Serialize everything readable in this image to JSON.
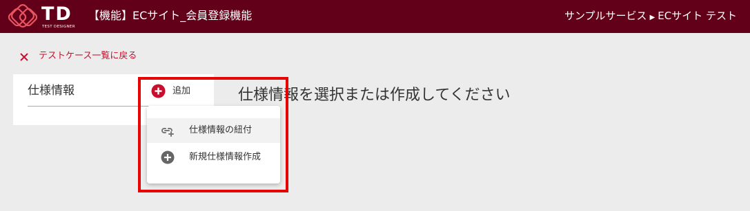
{
  "colors": {
    "header": "#620019",
    "accent": "#c8102e",
    "annotation": "#e60000"
  },
  "header": {
    "logo_text": "TD",
    "logo_subtext": "TEST DESIGNER",
    "page_title": "【機能】ECサイト_会員登録機能",
    "breadcrumb_service": "サンプルサービス",
    "breadcrumb_arrow": "▶",
    "breadcrumb_project": "ECサイト テスト"
  },
  "back_link": {
    "icon": "close-icon",
    "label": "テストケース一覧に戻る"
  },
  "spec_panel": {
    "title": "仕様情報",
    "add_button": {
      "icon": "plus-circle-icon",
      "label": "追加"
    }
  },
  "add_menu": {
    "items": [
      {
        "icon": "link-add-icon",
        "label": "仕様情報の紐付"
      },
      {
        "icon": "plus-circle-icon",
        "label": "新規仕様情報作成"
      }
    ]
  },
  "main": {
    "placeholder": "仕様情報を選択または作成してください"
  }
}
